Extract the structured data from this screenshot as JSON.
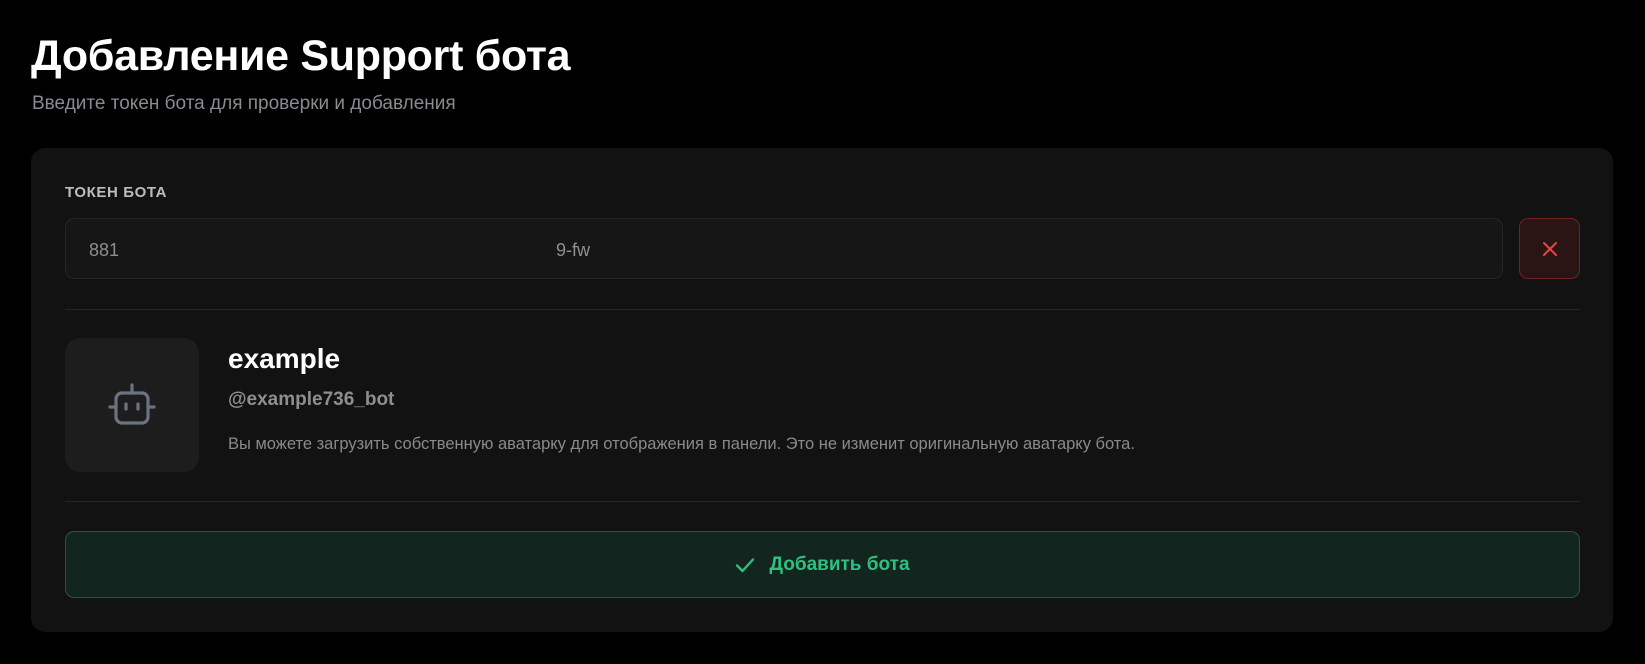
{
  "header": {
    "title": "Добавление Support бота",
    "subtitle": "Введите токен бота для проверки и добавления"
  },
  "token_field": {
    "label": "ТОКЕН БОТА",
    "value_start": "881",
    "value_end": "9-fw"
  },
  "bot": {
    "name": "example",
    "username": "@example736_bot",
    "avatar_hint": "Вы можете загрузить собственную аватарку для отображения в панели. Это не изменит оригинальную аватарку бота."
  },
  "actions": {
    "add_label": "Добавить бота"
  },
  "icons": {
    "clear": "close-icon",
    "avatar": "robot-icon",
    "confirm": "check-icon"
  },
  "colors": {
    "danger": "#e04848",
    "success": "#2fc07f",
    "muted": "#6b7280"
  }
}
